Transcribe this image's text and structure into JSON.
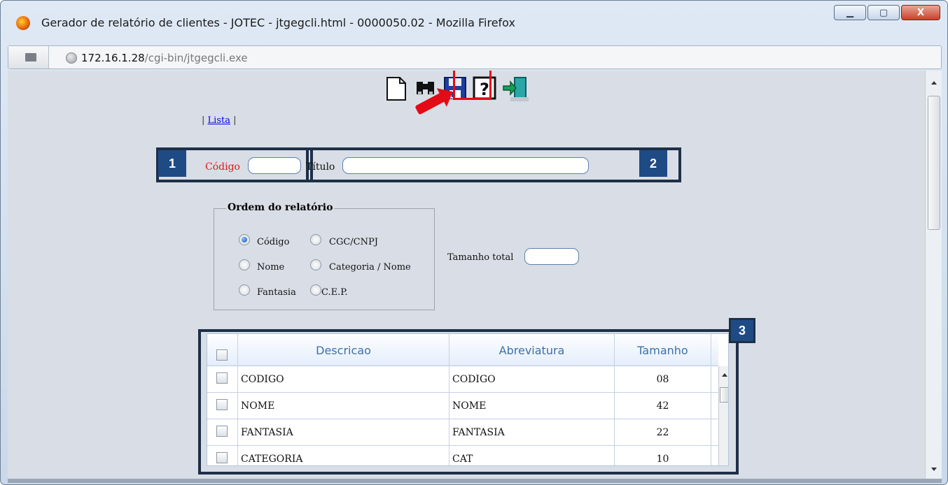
{
  "window": {
    "title": "Gerador de relatório de clientes - JOTEC - jtgegcli.html - 0000050.02 - Mozilla Firefox",
    "url_host": "172.16.1.28",
    "url_path": "/cgi-bin/jtgegcli.exe",
    "minimize_label": "▁",
    "maximize_label": "▢",
    "close_label": "X"
  },
  "toolbar": {
    "icons": [
      "new-document-icon",
      "binoculars-search-icon",
      "floppy-save-icon",
      "help-icon",
      "exit-door-icon"
    ],
    "highlighted": "floppy-save-icon",
    "highlight_color": "#e30b16"
  },
  "nav": {
    "prefix": "|",
    "link": "Lista",
    "suffix": "|"
  },
  "form": {
    "codigo_label": "Código",
    "codigo_value": "",
    "titulo_label": "Título",
    "titulo_value": "",
    "tamanho_label": "Tamanho total",
    "tamanho_value": ""
  },
  "order": {
    "legend": "Ordem do relatório",
    "options": [
      {
        "label": "Código",
        "selected": true
      },
      {
        "label": "CGC/CNPJ",
        "selected": false
      },
      {
        "label": "Nome",
        "selected": false
      },
      {
        "label": "Categoria / Nome",
        "selected": false
      },
      {
        "label": "Fantasia",
        "selected": false
      },
      {
        "label": "C.E.P.",
        "selected": false
      }
    ]
  },
  "callouts": {
    "one": "1",
    "two": "2",
    "three": "3",
    "box_color": "#1f4b85"
  },
  "table": {
    "headers": [
      "Descricao",
      "Abreviatura",
      "Tamanho"
    ],
    "rows": [
      {
        "descricao": "CODIGO",
        "abreviatura": "CODIGO",
        "tamanho": "08"
      },
      {
        "descricao": "NOME",
        "abreviatura": "NOME",
        "tamanho": "42"
      },
      {
        "descricao": "FANTASIA",
        "abreviatura": "FANTASIA",
        "tamanho": "22"
      },
      {
        "descricao": "CATEGORIA",
        "abreviatura": "CAT",
        "tamanho": "10"
      }
    ]
  }
}
